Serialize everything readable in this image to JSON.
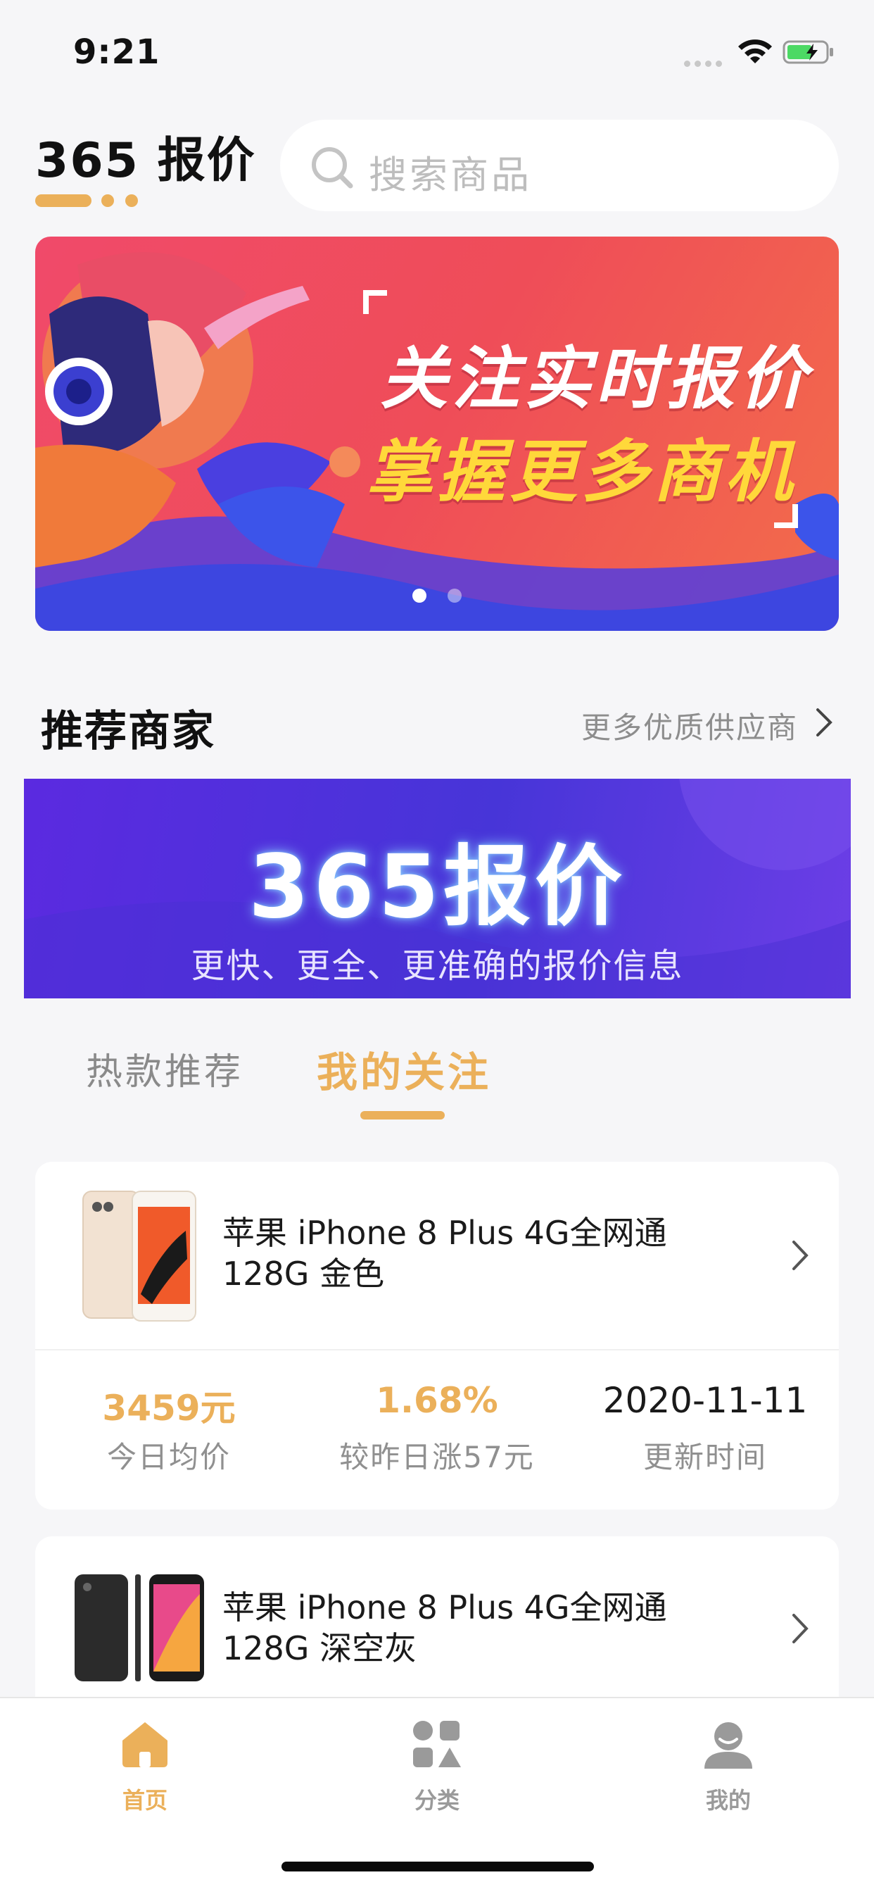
{
  "status_bar": {
    "time": "9:21"
  },
  "header": {
    "brand": "365 报价",
    "search_placeholder": "搜索商品"
  },
  "banner": {
    "line1": "关注实时报价",
    "line2": "掌握更多商机"
  },
  "recommended": {
    "title": "推荐商家",
    "more_label": "更多优质供应商",
    "promo_title": "365报价",
    "promo_subtitle": "更快、更全、更准确的报价信息"
  },
  "tabs": [
    {
      "label": "热款推荐",
      "active": false
    },
    {
      "label": "我的关注",
      "active": true
    }
  ],
  "products": [
    {
      "name_line1": "苹果 iPhone 8 Plus 4G全网通",
      "name_line2": "128G 金色",
      "stats": [
        {
          "value": "3459元",
          "label": "今日均价"
        },
        {
          "value": "1.68%",
          "label": "较昨日涨57元"
        },
        {
          "value": "2020-11-11",
          "label": "更新时间"
        }
      ]
    },
    {
      "name_line1": "苹果 iPhone 8 Plus 4G全网通",
      "name_line2": "128G 深空灰"
    }
  ],
  "tabbar": [
    {
      "label": "首页",
      "icon": "home-icon",
      "active": true
    },
    {
      "label": "分类",
      "icon": "category-icon",
      "active": false
    },
    {
      "label": "我的",
      "icon": "profile-icon",
      "active": false
    }
  ],
  "colors": {
    "accent": "#ebb05a",
    "inactive": "#9a9a9a",
    "background": "#f6f6f8"
  }
}
